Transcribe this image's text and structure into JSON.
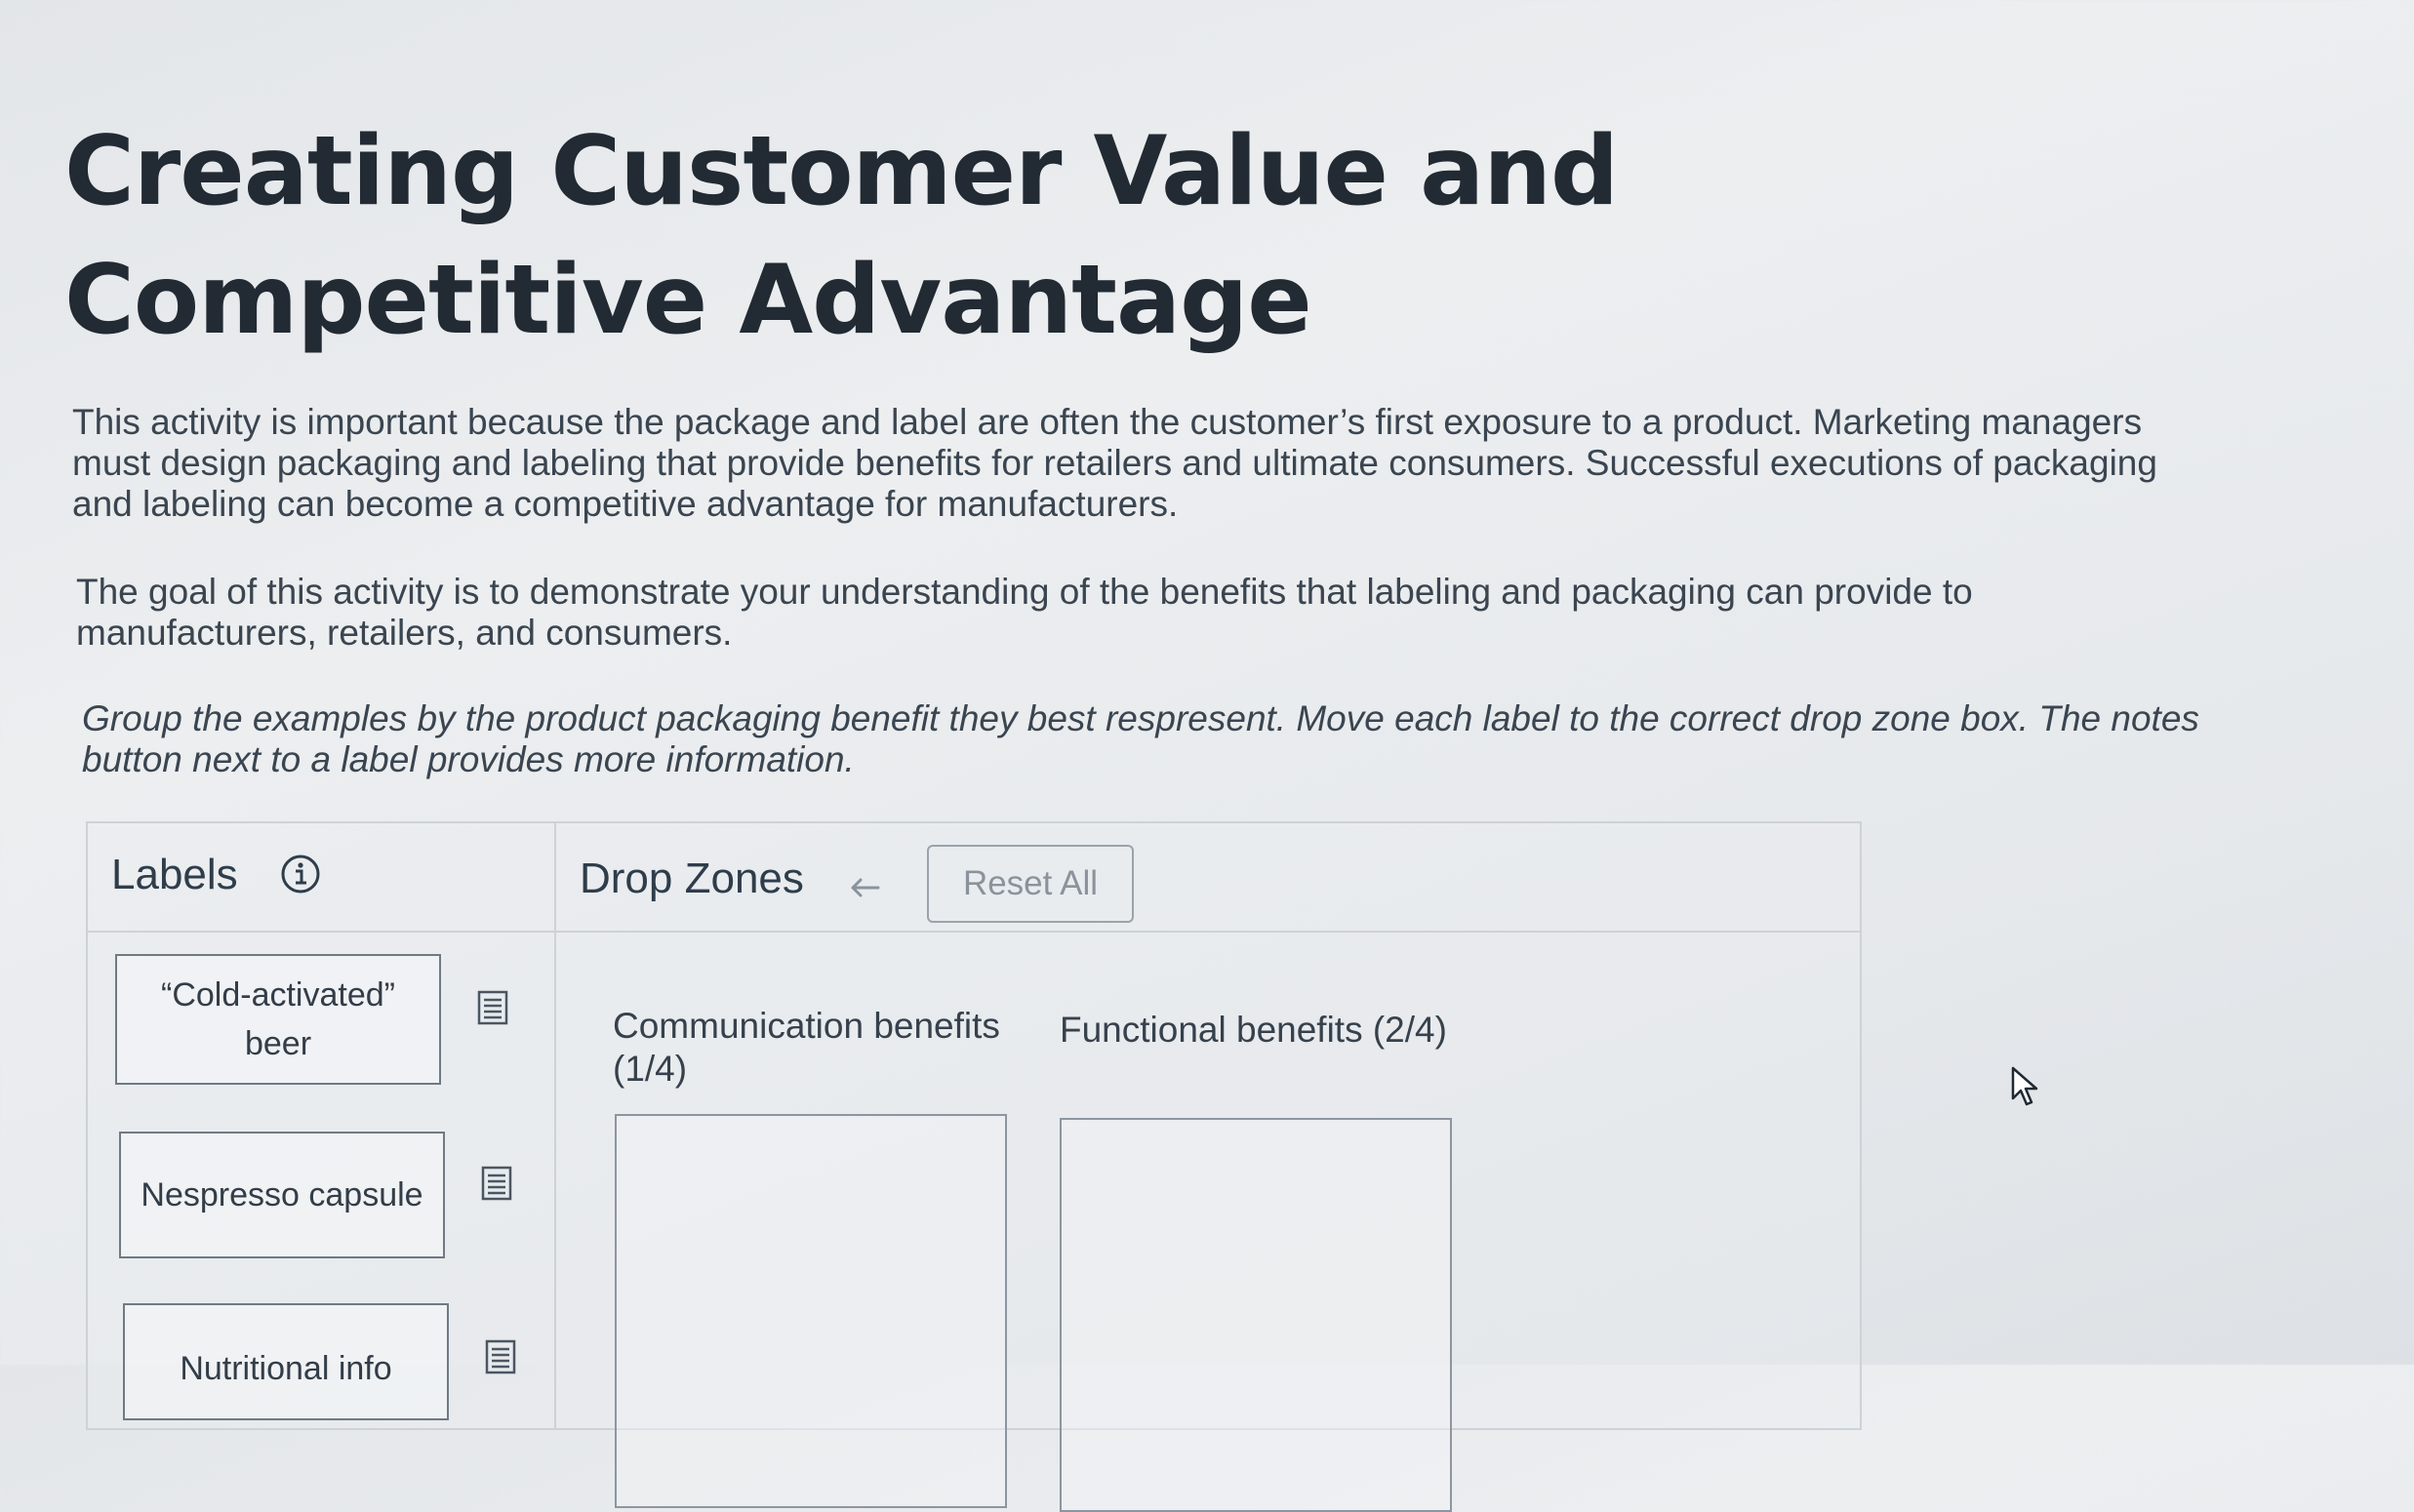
{
  "page": {
    "title": "Creating Customer Value and Competitive Advantage",
    "intro": "This activity is important because the package and label are often the customer’s first exposure to a product. Marketing managers must design packaging and labeling that provide benefits for retailers and ultimate consumers. Successful executions of packaging and labeling can become a competitive advantage for manufacturers.",
    "goal": "The goal of this activity is to demonstrate your understanding of the benefits that labeling and packaging can provide to manufacturers, retailers, and consumers.",
    "instructions": "Group the examples by the product packaging benefit they best respresent. Move each label to the correct drop zone box. The notes button next to a label provides more information."
  },
  "activity": {
    "labels_heading": "Labels",
    "dropzones_heading": "Drop Zones",
    "reset_all_label": "Reset All",
    "labels": [
      {
        "text": "“Cold-activated” beer"
      },
      {
        "text": "Nespresso capsule"
      },
      {
        "text": "Nutritional info"
      }
    ],
    "zones": [
      {
        "label": "Communication benefits (1/4)"
      },
      {
        "label": "Functional benefits (2/4)"
      }
    ]
  },
  "icons": {
    "info": "info-icon",
    "undo": "undo-arrow-icon",
    "notes": "notes-icon",
    "cursor": "mouse-cursor"
  },
  "colors": {
    "background": "#e6e9ec",
    "text": "#2c3742",
    "border": "#6f7a85",
    "muted_button_text": "#8a939c"
  }
}
